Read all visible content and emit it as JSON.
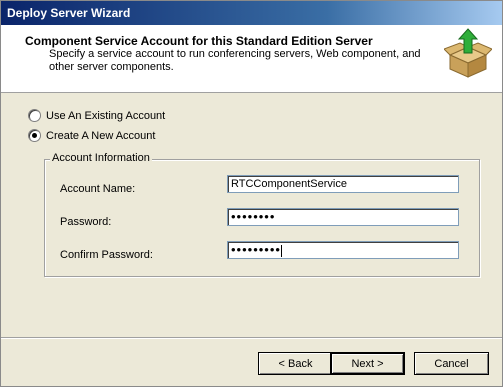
{
  "window": {
    "title": "Deploy Server Wizard"
  },
  "header": {
    "title": "Component Service Account for this Standard Edition Server",
    "subtitle": "Specify a service account to run conferencing servers, Web component, and other server components.",
    "icon": "box-with-green-arrow-icon"
  },
  "options": {
    "existing": {
      "label": "Use An Existing Account",
      "selected": false
    },
    "create": {
      "label": "Create A New Account",
      "selected": true
    }
  },
  "group": {
    "legend": "Account Information",
    "account_name": {
      "label": "Account Name:",
      "value": "RTCComponentService"
    },
    "password": {
      "label": "Password:",
      "value": "••••••••"
    },
    "confirm_password": {
      "label": "Confirm Password:",
      "value": "•••••••••"
    }
  },
  "buttons": {
    "back": "< Back",
    "next": "Next >",
    "cancel": "Cancel"
  }
}
